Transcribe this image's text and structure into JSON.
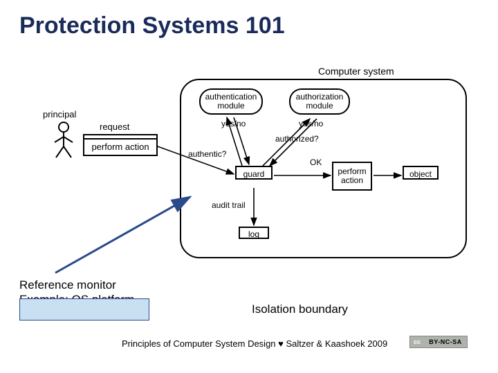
{
  "title": "Protection Systems 101",
  "diagram": {
    "system_label": "Computer system",
    "principal_label": "principal",
    "request_label": "request",
    "perform_action": "perform action",
    "auth_module": "authentication\nmodule",
    "authz_module": "authorization\nmodule",
    "yes_no": "yes/no",
    "authorized_q": "authorized?",
    "authentic_q": "authentic?",
    "guard": "guard",
    "ok": "OK",
    "perform_action2": "perform\naction",
    "object": "object",
    "audit_trail": "audit trail",
    "log": "log"
  },
  "annotations": {
    "ref_line1": "Reference monitor",
    "ref_line2_a": "Example:",
    "ref_line2_b": " OS platform",
    "iso_label": "Isolation boundary"
  },
  "footer": {
    "text": "Principles of Computer System Design ♥ Saltzer & Kaashoek 2009",
    "cc_left": "cc",
    "cc_right": "BY-NC-SA"
  }
}
